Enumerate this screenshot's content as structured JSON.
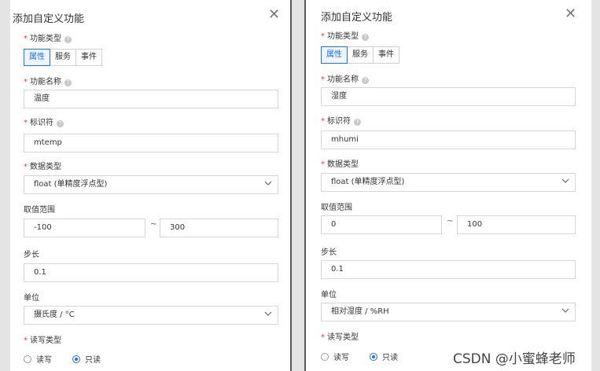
{
  "left_panel": {
    "title": "添加自定义功能",
    "close_glyph": "✕",
    "function_type": {
      "label": "功能类型",
      "options": [
        "属性",
        "服务",
        "事件"
      ],
      "selected": "属性"
    },
    "function_name": {
      "label": "功能名称",
      "value": "温度"
    },
    "identifier": {
      "label": "标识符",
      "value": "mtemp"
    },
    "data_type": {
      "label": "数据类型",
      "value": "float (单精度浮点型)"
    },
    "range": {
      "label": "取值范围",
      "min": "-100",
      "tilde": "~",
      "max": "300"
    },
    "step": {
      "label": "步长",
      "value": "0.1"
    },
    "unit": {
      "label": "单位",
      "value": "摄氏度 / °C"
    },
    "rw_type": {
      "label": "读写类型",
      "options": [
        "读写",
        "只读"
      ],
      "selected": "只读"
    }
  },
  "right_panel": {
    "title": "添加自定义功能",
    "close_glyph": "✕",
    "function_type": {
      "label": "功能类型",
      "options": [
        "属性",
        "服务",
        "事件"
      ],
      "selected": "属性"
    },
    "function_name": {
      "label": "功能名称",
      "value": "湿度"
    },
    "identifier": {
      "label": "标识符",
      "value": "mhumi"
    },
    "data_type": {
      "label": "数据类型",
      "value": "float (单精度浮点型)"
    },
    "range": {
      "label": "取值范围",
      "min": "0",
      "tilde": "~",
      "max": "100"
    },
    "step": {
      "label": "步长",
      "value": "0.1"
    },
    "unit": {
      "label": "单位",
      "value": "相对湿度 / %RH"
    },
    "rw_type": {
      "label": "读写类型",
      "options": [
        "读写",
        "只读"
      ],
      "selected": "只读"
    }
  },
  "required_mark": "*",
  "help_glyph": "?",
  "watermark": "CSDN @小蜜蜂老师",
  "colors": {
    "accent": "#1b72e8",
    "required": "#e04040",
    "backdrop": "#e4e4e4"
  }
}
